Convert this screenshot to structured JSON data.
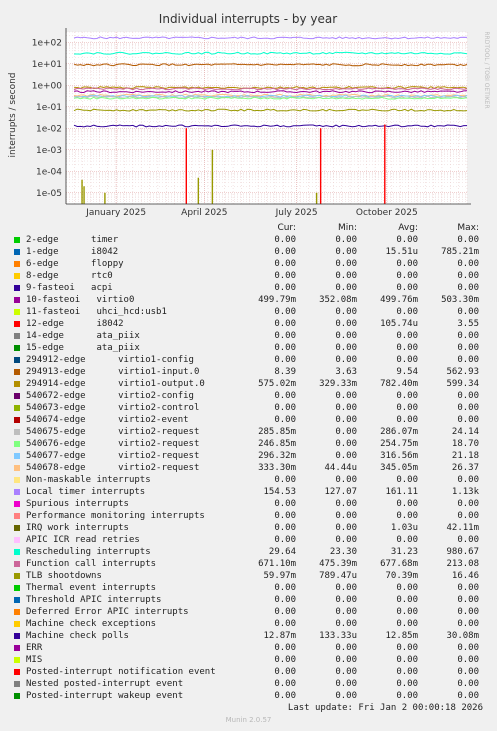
{
  "chart_data": {
    "type": "line",
    "title": "Individual interrupts - by year",
    "ylabel": "interrupts / second",
    "watermark": "RRDTOOL / TOBI OETIKER",
    "y_scale": "log",
    "ylim": [
      3e-06,
      300
    ],
    "y_ticks": [
      {
        "value": 100,
        "label": "1e+02"
      },
      {
        "value": 10,
        "label": "1e+01"
      },
      {
        "value": 1,
        "label": "1e+00"
      },
      {
        "value": 0.1,
        "label": "1e-01"
      },
      {
        "value": 0.01,
        "label": "1e-02"
      },
      {
        "value": 0.001,
        "label": "1e-03"
      },
      {
        "value": 0.0001,
        "label": "1e-04"
      },
      {
        "value": 1e-05,
        "label": "1e-05"
      }
    ],
    "x_ticks": [
      "January 2025",
      "April 2025",
      "July 2025",
      "October 2025"
    ],
    "columns": [
      "Cur:",
      "Min:",
      "Avg:",
      "Max:"
    ],
    "series": [
      {
        "name": "2-edge      timer",
        "color": "#00cc00",
        "values": [
          "0.00",
          "0.00",
          "0.00",
          "0.00"
        ]
      },
      {
        "name": "1-edge      i8042",
        "color": "#0066b3",
        "values": [
          "0.00",
          "0.00",
          "15.51u",
          "785.21m"
        ]
      },
      {
        "name": "6-edge      floppy",
        "color": "#ff8000",
        "values": [
          "0.00",
          "0.00",
          "0.00",
          "0.00"
        ]
      },
      {
        "name": "8-edge      rtc0",
        "color": "#ffcc00",
        "values": [
          "0.00",
          "0.00",
          "0.00",
          "0.00"
        ]
      },
      {
        "name": "9-fasteoi   acpi",
        "color": "#330099",
        "values": [
          "0.00",
          "0.00",
          "0.00",
          "0.00"
        ]
      },
      {
        "name": "10-fasteoi   virtio0",
        "color": "#990099",
        "values": [
          "499.79m",
          "352.08m",
          "499.76m",
          "503.30m"
        ]
      },
      {
        "name": "11-fasteoi   uhci_hcd:usb1",
        "color": "#ccff00",
        "values": [
          "0.00",
          "0.00",
          "0.00",
          "0.00"
        ]
      },
      {
        "name": "12-edge      i8042",
        "color": "#ff0000",
        "values": [
          "0.00",
          "0.00",
          "105.74u",
          "3.55"
        ]
      },
      {
        "name": "14-edge      ata_piix",
        "color": "#808080",
        "values": [
          "0.00",
          "0.00",
          "0.00",
          "0.00"
        ]
      },
      {
        "name": "15-edge      ata_piix",
        "color": "#008f00",
        "values": [
          "0.00",
          "0.00",
          "0.00",
          "0.00"
        ]
      },
      {
        "name": "294912-edge      virtio1-config",
        "color": "#00487d",
        "values": [
          "0.00",
          "0.00",
          "0.00",
          "0.00"
        ]
      },
      {
        "name": "294913-edge      virtio1-input.0",
        "color": "#b35a00",
        "values": [
          "8.39",
          "3.63",
          "9.54",
          "562.93"
        ]
      },
      {
        "name": "294914-edge      virtio1-output.0",
        "color": "#b38f00",
        "values": [
          "575.02m",
          "329.33m",
          "782.40m",
          "599.34"
        ]
      },
      {
        "name": "540672-edge      virtio2-config",
        "color": "#6b006b",
        "values": [
          "0.00",
          "0.00",
          "0.00",
          "0.00"
        ]
      },
      {
        "name": "540673-edge      virtio2-control",
        "color": "#8fb300",
        "values": [
          "0.00",
          "0.00",
          "0.00",
          "0.00"
        ]
      },
      {
        "name": "540674-edge      virtio2-event",
        "color": "#b30000",
        "values": [
          "0.00",
          "0.00",
          "0.00",
          "0.00"
        ]
      },
      {
        "name": "540675-edge      virtio2-request",
        "color": "#bebebe",
        "values": [
          "285.85m",
          "0.00",
          "286.07m",
          "24.14"
        ]
      },
      {
        "name": "540676-edge      virtio2-request",
        "color": "#80ff80",
        "values": [
          "246.85m",
          "0.00",
          "254.75m",
          "18.70"
        ]
      },
      {
        "name": "540677-edge      virtio2-request",
        "color": "#80c9ff",
        "values": [
          "296.32m",
          "0.00",
          "316.56m",
          "21.18"
        ]
      },
      {
        "name": "540678-edge      virtio2-request",
        "color": "#ffc080",
        "values": [
          "333.30m",
          "44.44u",
          "345.05m",
          "26.37"
        ]
      },
      {
        "name": "Non-maskable interrupts",
        "color": "#ffe680",
        "values": [
          "0.00",
          "0.00",
          "0.00",
          "0.00"
        ]
      },
      {
        "name": "Local timer interrupts",
        "color": "#aa80ff",
        "values": [
          "154.53",
          "127.07",
          "161.11",
          "1.13k"
        ]
      },
      {
        "name": "Spurious interrupts",
        "color": "#ee00cc",
        "values": [
          "0.00",
          "0.00",
          "0.00",
          "0.00"
        ]
      },
      {
        "name": "Performance monitoring interrupts",
        "color": "#ff8080",
        "values": [
          "0.00",
          "0.00",
          "0.00",
          "0.00"
        ]
      },
      {
        "name": "IRQ work interrupts",
        "color": "#666600",
        "values": [
          "0.00",
          "0.00",
          "1.03u",
          "42.11m"
        ]
      },
      {
        "name": "APIC ICR read retries",
        "color": "#ffbfff",
        "values": [
          "0.00",
          "0.00",
          "0.00",
          "0.00"
        ]
      },
      {
        "name": "Rescheduling interrupts",
        "color": "#00ffcc",
        "values": [
          "29.64",
          "23.30",
          "31.23",
          "980.67"
        ]
      },
      {
        "name": "Function call interrupts",
        "color": "#cc6699",
        "values": [
          "671.10m",
          "475.39m",
          "677.68m",
          "213.08"
        ]
      },
      {
        "name": "TLB shootdowns",
        "color": "#999900",
        "values": [
          "59.97m",
          "789.47u",
          "70.39m",
          "16.46"
        ]
      },
      {
        "name": "Thermal event interrupts",
        "color": "#00cc00",
        "values": [
          "0.00",
          "0.00",
          "0.00",
          "0.00"
        ]
      },
      {
        "name": "Threshold APIC interrupts",
        "color": "#0066b3",
        "values": [
          "0.00",
          "0.00",
          "0.00",
          "0.00"
        ]
      },
      {
        "name": "Deferred Error APIC interrupts",
        "color": "#ff8000",
        "values": [
          "0.00",
          "0.00",
          "0.00",
          "0.00"
        ]
      },
      {
        "name": "Machine check exceptions",
        "color": "#ffcc00",
        "values": [
          "0.00",
          "0.00",
          "0.00",
          "0.00"
        ]
      },
      {
        "name": "Machine check polls",
        "color": "#330099",
        "values": [
          "12.87m",
          "133.33u",
          "12.85m",
          "30.08m"
        ]
      },
      {
        "name": "ERR",
        "color": "#990099",
        "values": [
          "0.00",
          "0.00",
          "0.00",
          "0.00"
        ]
      },
      {
        "name": "MIS",
        "color": "#ccff00",
        "values": [
          "0.00",
          "0.00",
          "0.00",
          "0.00"
        ]
      },
      {
        "name": "Posted-interrupt notification event",
        "color": "#ff0000",
        "values": [
          "0.00",
          "0.00",
          "0.00",
          "0.00"
        ]
      },
      {
        "name": "Nested posted-interrupt event",
        "color": "#808080",
        "values": [
          "0.00",
          "0.00",
          "0.00",
          "0.00"
        ]
      },
      {
        "name": "Posted-interrupt wakeup event",
        "color": "#008f00",
        "values": [
          "0.00",
          "0.00",
          "0.00",
          "0.00"
        ]
      }
    ],
    "plot_lines": [
      {
        "color": "#aa80ff",
        "level": 160
      },
      {
        "color": "#00ffcc",
        "level": 31
      },
      {
        "color": "#b35a00",
        "level": 9
      },
      {
        "color": "#b38f00",
        "level": 0.78
      },
      {
        "color": "#cc6699",
        "level": 0.68
      },
      {
        "color": "#990099",
        "level": 0.5
      },
      {
        "color": "#ffc080",
        "level": 0.34
      },
      {
        "color": "#80c9ff",
        "level": 0.31
      },
      {
        "color": "#bebebe",
        "level": 0.28
      },
      {
        "color": "#80ff80",
        "level": 0.25
      },
      {
        "color": "#999900",
        "level": 0.07
      },
      {
        "color": "#330099",
        "level": 0.0128
      }
    ],
    "spikes": [
      {
        "color": "#ff0000",
        "pos": 0.3,
        "value": 0.01
      },
      {
        "color": "#ff0000",
        "pos": 0.635,
        "value": 0.01
      },
      {
        "color": "#ff0000",
        "pos": 0.795,
        "value": 0.015
      },
      {
        "color": "#999900",
        "pos": 0.04,
        "value": 4e-05
      },
      {
        "color": "#999900",
        "pos": 0.045,
        "value": 2e-05
      },
      {
        "color": "#999900",
        "pos": 0.097,
        "value": 1e-05
      },
      {
        "color": "#999900",
        "pos": 0.33,
        "value": 5e-05
      },
      {
        "color": "#999900",
        "pos": 0.365,
        "value": 0.001
      },
      {
        "color": "#999900",
        "pos": 0.625,
        "value": 1e-05
      }
    ]
  },
  "footer": {
    "last_update": "Last update:  Fri Jan  2 00:00:18 2026",
    "generator": "Munin 2.0.57"
  }
}
